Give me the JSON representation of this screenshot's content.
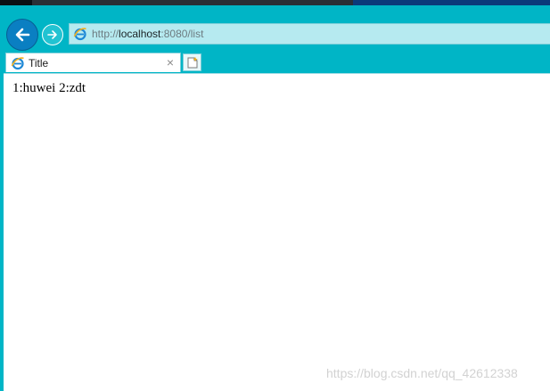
{
  "browser": {
    "address": {
      "scheme": "http://",
      "host": "localhost",
      "rest": ":8080/list"
    },
    "tabs": [
      {
        "title": "Title",
        "close_glyph": "×"
      }
    ],
    "icons": {
      "back": "back-arrow-icon",
      "forward": "forward-arrow-icon",
      "page": "ie-page-icon",
      "new_tab": "new-tab-icon"
    },
    "colors": {
      "chrome": "#00b5c6",
      "back_button": "#0a7fc2",
      "address_bg": "#b6eaf0"
    }
  },
  "page": {
    "body_text": "1:huwei 2:zdt"
  },
  "watermark": "https://blog.csdn.net/qq_42612338"
}
